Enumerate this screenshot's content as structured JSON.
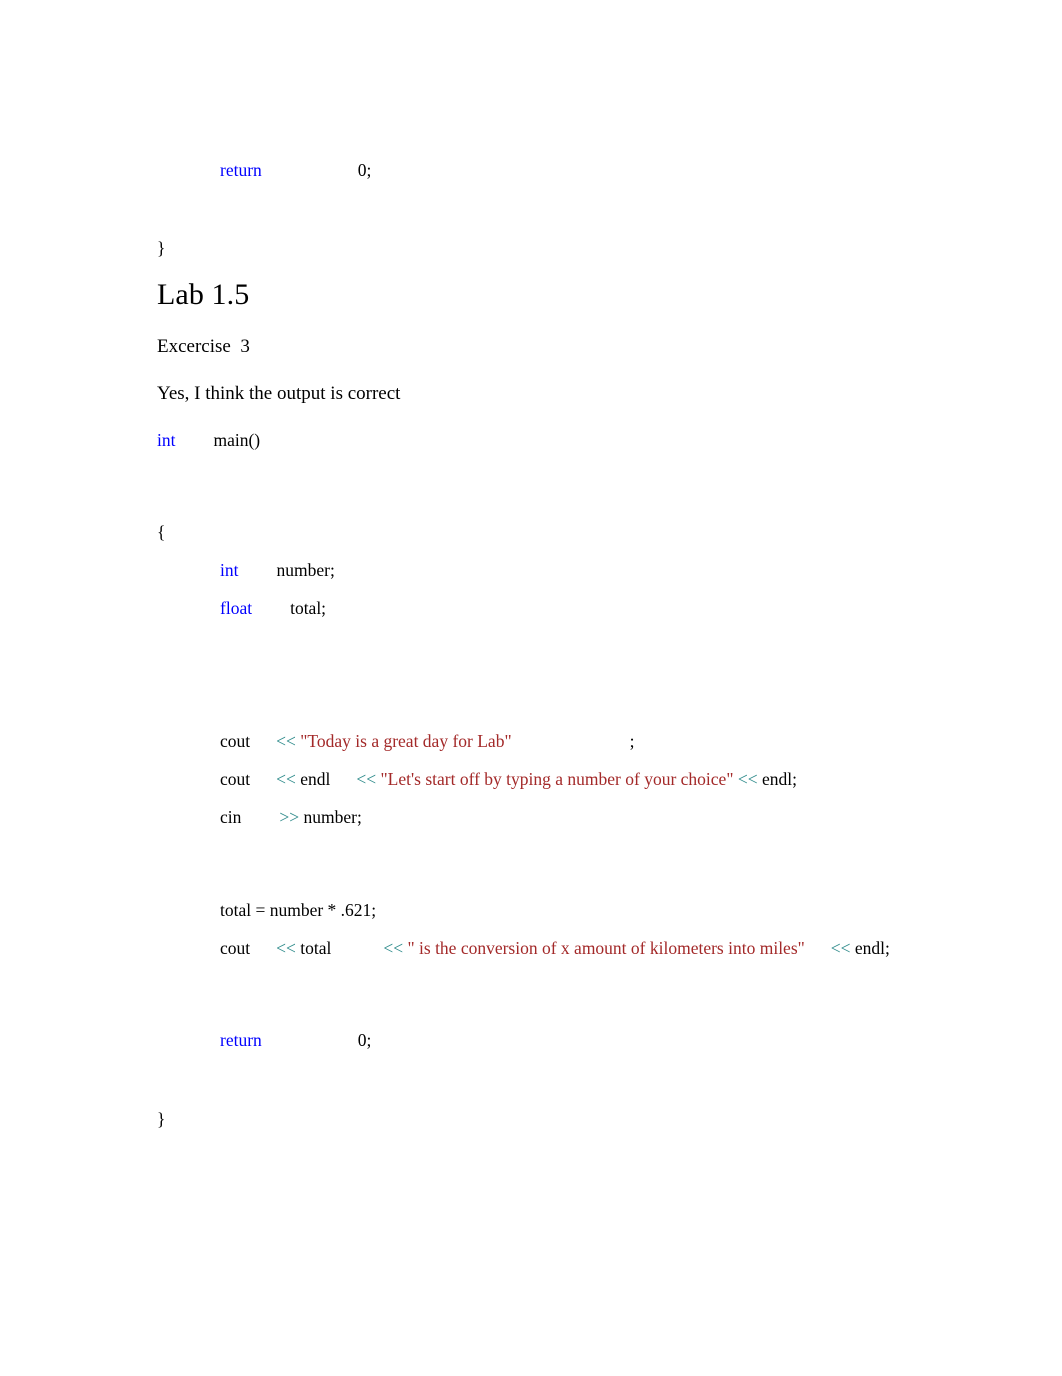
{
  "document": {
    "code_top": {
      "return_keyword": "return",
      "return_value": "0;",
      "closing_brace": "}"
    },
    "heading": "Lab 1.5",
    "exercise_label": "Excercise  3",
    "answer_text": "Yes, I think the output is correct",
    "program": {
      "signature_keyword": "int",
      "signature_name": "main()",
      "open_brace": "{",
      "decl_int_keyword": "int",
      "decl_int_name": "number;",
      "decl_float_keyword": "float",
      "decl_float_name": "total;",
      "cout1_stream": "cout",
      "cout1_op": "<<",
      "cout1_string": "\"Today is a great day for Lab\"",
      "cout1_terminator": ";",
      "cout2_stream": "cout",
      "cout2_op1": "<<",
      "cout2_endl1": "endl",
      "cout2_op2": "<<",
      "cout2_string": "\"Let's start off by typing a number of your choice\"",
      "cout2_op3": "<<",
      "cout2_endl2": "endl;",
      "cin_stream": "cin",
      "cin_op": ">>",
      "cin_var": "number;",
      "assignment": "total = number * .621;",
      "cout3_stream": "cout",
      "cout3_op1": "<<",
      "cout3_var": "total",
      "cout3_op2": "<<",
      "cout3_string": "\" is the conversion of x amount of kilometers into miles\"",
      "cout3_op3": "<<",
      "cout3_endl": "endl;",
      "return_keyword": "return",
      "return_value": "0;",
      "close_brace": "}"
    }
  },
  "colors": {
    "keyword": "#0000ff",
    "operator": "#2e8b8b",
    "string": "#a32929",
    "text": "#000000",
    "background": "#ffffff"
  }
}
